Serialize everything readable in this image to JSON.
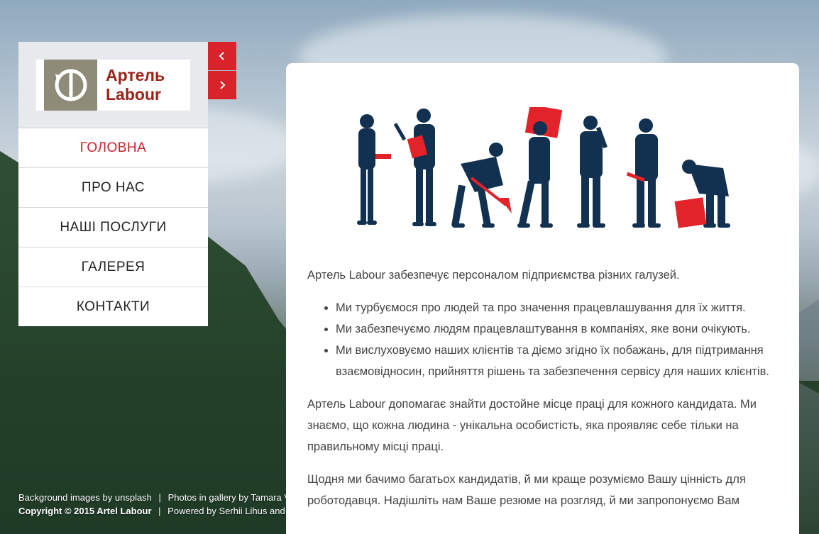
{
  "logo": {
    "line1": "Артель",
    "line2": "Labour",
    "colors": {
      "mark_bg": "#8e8b79",
      "text": "#9b2216"
    }
  },
  "nav": {
    "items": [
      {
        "label": "ГОЛОВНА",
        "active": true
      },
      {
        "label": "ПРО НАС",
        "active": false
      },
      {
        "label": "НАШІ ПОСЛУГИ",
        "active": false
      },
      {
        "label": "ГАЛЕРЕЯ",
        "active": false
      },
      {
        "label": "КОНТАКТИ",
        "active": false
      }
    ]
  },
  "arrows": {
    "prev_icon": "chevron-left-icon",
    "next_icon": "chevron-right-icon"
  },
  "footer": {
    "bg_credit_prefix": "Background images by",
    "bg_credit_link": "unsplash",
    "gallery_prefix": "Photos in gallery by",
    "gallery_name": "Tamara V",
    "copyright": "Copyright © 2015 Artel Labour",
    "powered_prefix": "Powered by",
    "powered_name": "Serhii Lihus and"
  },
  "content": {
    "intro": "Артель Labour забезпечує персоналом підприємства різних галузей.",
    "bullets": [
      "Ми турбуємося про людей та про значення працевлашування для їх життя.",
      "Ми забезпечуємо людям працевлаштування в компаніях, яке вони очікують.",
      "Ми вислуховуємо наших клієнтів та діємо згідно їх побажань, для підтримання взаємовідносин, прийняття рішень та забезпечення сервісу для наших клієнтів."
    ],
    "para2": "Артель Labour допомагає знайти достойне місце праці для кожного кандидата. Ми знаємо, що кожна людина - унікальна особистість, яка проявляє себе тільки на правильному місці праці.",
    "para3": "Щодня ми бачимо багатьох кандидатів, й ми краще розуміємо Вашу цінність для роботодавця. Надішліть нам Ваше резюме на розгляд, й ми запропонуємо Вам"
  },
  "colors": {
    "accent": "#d8232a",
    "worker": "#12304f",
    "prop": "#e2232a"
  }
}
